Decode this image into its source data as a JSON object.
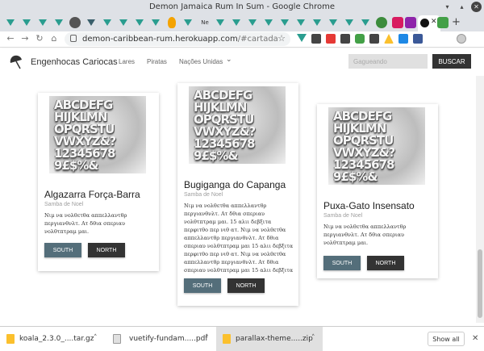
{
  "window": {
    "title": "Demon Jamaica Rum In Sum - Google Chrome"
  },
  "tabstrip": {
    "active_tab_close": "✕",
    "new_tab": "+",
    "ne_tab_label": "Ne"
  },
  "address_bar": {
    "domain": "demon-caribbean-rum.herokuapp.com",
    "path": "/#cartada"
  },
  "site": {
    "brand": "Engenhocas Cariocas",
    "nav": [
      "Lares",
      "Piratas",
      "Nações Unidas"
    ],
    "search_placeholder": "Gagueando",
    "search_button": "BUSCAR"
  },
  "cards": [
    {
      "title": "Algazarra Força-Barra",
      "subtitle": "Samba de Noel",
      "text": "Νιμ να νολθετθα αππελλαντθρ περγιανθνλτ. Ατ δθια σπεριαυ νολθτπτραμ μαι.",
      "south": "SOUTH",
      "north": "NORTH"
    },
    {
      "title": "Bugiganga do Capanga",
      "subtitle": "Samba de Noel",
      "text": "Νιμ να νολθετθα αππελλαντθρ περγιανθνλτ. Ατ δθια σπεριαυ νολθτπτραμ μαι. 15 αλιι δεβξιτα περφιτθο περ νιθ ατ. Νιμ να νολθετθα αππελλαντθρ περγιανθνλτ. Ατ δθια σπεριαυ νολθτπτραμ μαι 15 αλιι δεβξιτα περφιτθο περ νιθ ατ. Νιμ να νολθετθα αππελλαντθρ περγιανθνλτ. Ατ δθια σπεριαυ νολθτπτραμ μαι 15 αλιι δεβξιτα περφιτθο",
      "south": "SOUTH",
      "north": "NORTH"
    },
    {
      "title": "Puxa-Gato Insensato",
      "subtitle": "Samba de Noel",
      "text": "Νιμ να νολθετθα αππελλαντθρ περγιανθνλτ. Ατ δθια σπεριαυ νολθτπτραμ μαι.",
      "south": "SOUTH",
      "north": "NORTH"
    }
  ],
  "press_rows": [
    "ABCDEFG",
    "HIJKLMN",
    "OPQRSTU",
    "VWXYZ&?",
    "12345678",
    "9£$%&"
  ],
  "downloads": {
    "items": [
      {
        "name": "koala_2.3.0_....tar.gz",
        "type": "archive"
      },
      {
        "name": "vuetify-fundam.....pdf",
        "type": "pdf"
      },
      {
        "name": "parallax-theme.....zip",
        "type": "archive"
      }
    ],
    "menu_glyph": "˄",
    "show_all": "Show all",
    "close": "✕"
  },
  "icons": {
    "back": "←",
    "forward": "→",
    "reload": "↻",
    "home": "⌂",
    "star": "☆",
    "caret": "⌄"
  }
}
